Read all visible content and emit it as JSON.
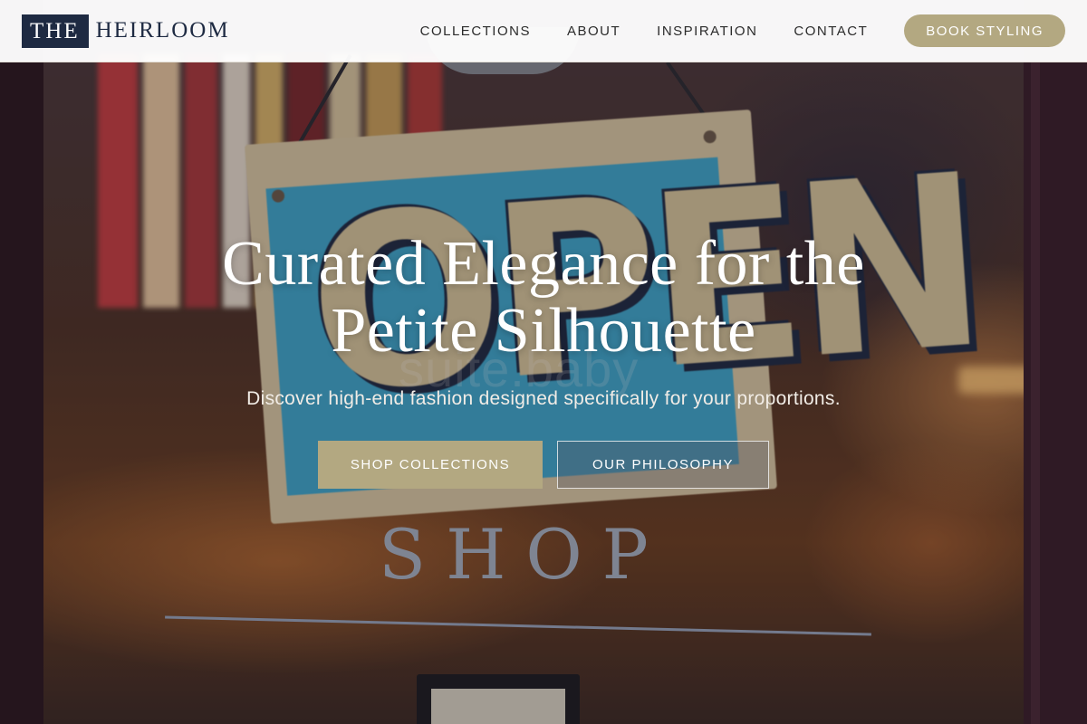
{
  "brand": {
    "logo_box_text": "THE",
    "logo_rest_text": "HEIRLOOM"
  },
  "nav": {
    "items": [
      {
        "label": "COLLECTIONS"
      },
      {
        "label": "ABOUT"
      },
      {
        "label": "INSPIRATION"
      },
      {
        "label": "CONTACT"
      }
    ],
    "cta_label": "BOOK STYLING"
  },
  "hero": {
    "headline_line1": "Curated Elegance for the",
    "headline_line2": "Petite Silhouette",
    "subheadline": "Discover high-end fashion designed specifically for your proportions.",
    "primary_button": "SHOP COLLECTIONS",
    "secondary_button": "OUR PHILOSOPHY",
    "photo_sign_text": "OPEN",
    "photo_door_text": "SHOP",
    "watermark_text": "suite.baby"
  },
  "colors": {
    "accent": "#b3a881",
    "brand_navy": "#1e2a42",
    "header_bg": "#ffffff"
  }
}
